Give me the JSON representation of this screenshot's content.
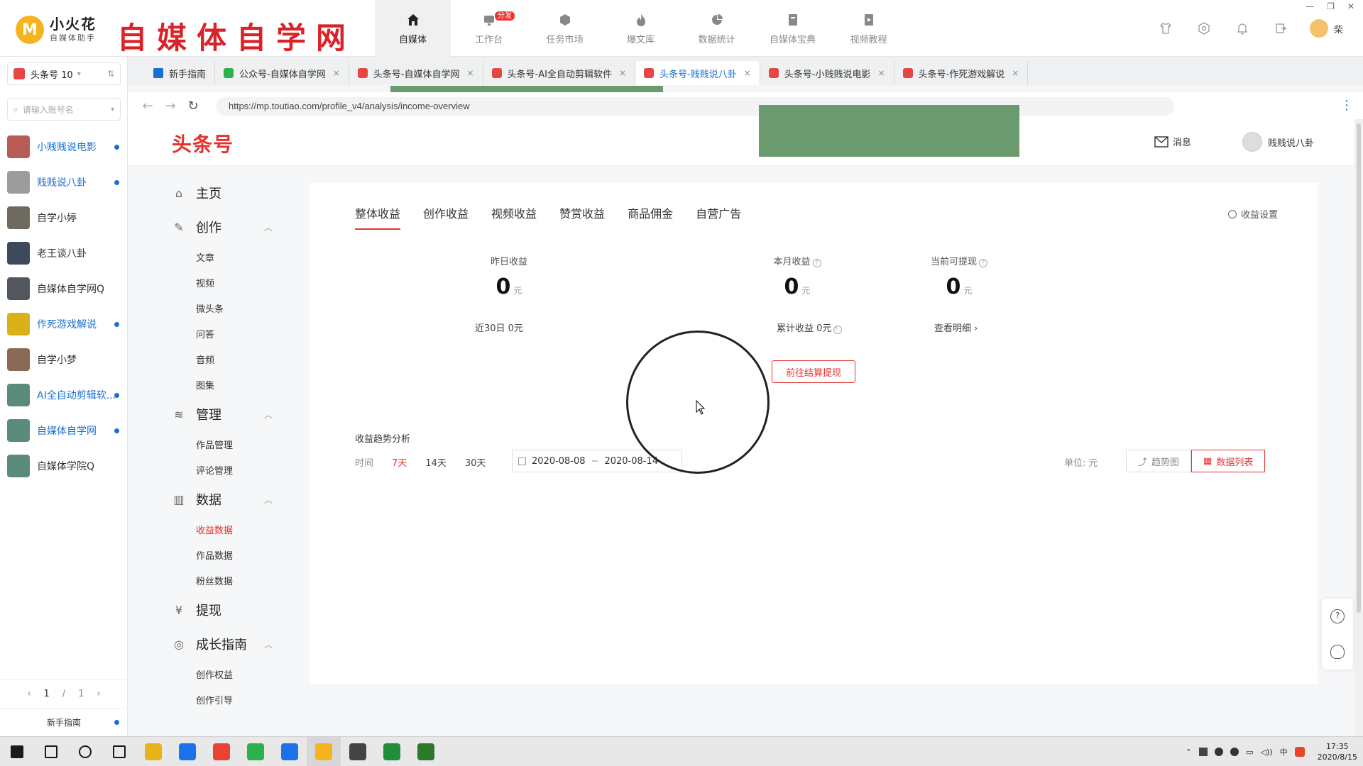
{
  "app": {
    "logo_name": "小火花",
    "logo_sub": "自媒体助手",
    "brand_banner": "自媒体自学网",
    "window_controls": [
      "—",
      "❐",
      "✕"
    ],
    "user_name": "柴"
  },
  "top_nav": [
    {
      "label": "自媒体",
      "icon": "home-icon",
      "active": true
    },
    {
      "label": "工作台",
      "icon": "workbench-icon",
      "badge": "分发"
    },
    {
      "label": "任务市场",
      "icon": "cube-icon"
    },
    {
      "label": "爆文库",
      "icon": "fire-icon"
    },
    {
      "label": "数据统计",
      "icon": "pie-chart-icon"
    },
    {
      "label": "自媒体宝典",
      "icon": "book-icon"
    },
    {
      "label": "视频教程",
      "icon": "video-doc-icon"
    }
  ],
  "header_icons": [
    "shirt-icon",
    "settings-hex-icon",
    "bell-icon",
    "logout-icon"
  ],
  "account_sidebar": {
    "platform": "头条号 10",
    "search_placeholder": "请输入账号名",
    "accounts": [
      {
        "name": "小贱贱说电影",
        "online": true,
        "color": "#b95b55"
      },
      {
        "name": "贱贱说八卦",
        "online": true,
        "color": "#9c9c9c"
      },
      {
        "name": "自学小婷",
        "online": false,
        "color": "#6f6a60"
      },
      {
        "name": "老王谈八卦",
        "online": false,
        "color": "#3d4a5b"
      },
      {
        "name": "自媒体自学网Q",
        "online": false,
        "color": "#52575d"
      },
      {
        "name": "作死游戏解说",
        "online": true,
        "color": "#d9b21a"
      },
      {
        "name": "自学小梦",
        "online": false,
        "color": "#8a6a55"
      },
      {
        "name": "AI全自动剪辑软...",
        "online": true,
        "color": "#5b8c7a"
      },
      {
        "name": "自媒体自学网",
        "online": true,
        "color": "#5b8c7a"
      },
      {
        "name": "自媒体学院Q",
        "online": false,
        "color": "#5b8c7a"
      }
    ],
    "pager": {
      "prev": "‹",
      "current": "1",
      "sep": "/",
      "total": "1",
      "next": "›"
    },
    "guide": "新手指南"
  },
  "browser": {
    "tabs": [
      {
        "label": "新手指南",
        "icon_color": "#1a6fd1",
        "closable": false
      },
      {
        "label": "公众号-自媒体自学网",
        "icon_color": "#2bb24c",
        "closable": true
      },
      {
        "label": "头条号-自媒体自学网",
        "icon_color": "#e84545",
        "closable": true
      },
      {
        "label": "头条号-AI全自动剪辑软件",
        "icon_color": "#e84545",
        "closable": true
      },
      {
        "label": "头条号-贱贱说八卦",
        "icon_color": "#e84545",
        "closable": true,
        "active": true
      },
      {
        "label": "头条号-小贱贱说电影",
        "icon_color": "#e84545",
        "closable": true
      },
      {
        "label": "头条号-作死游戏解说",
        "icon_color": "#e84545",
        "closable": true
      }
    ],
    "close_glyph": "×",
    "url": "https://mp.toutiao.com/profile_v4/analysis/income-overview"
  },
  "site": {
    "logo": "头条号",
    "messages": "消息",
    "user": "贱贱说八卦"
  },
  "site_nav": [
    {
      "title": "主页",
      "icon": "home-outline-icon",
      "items": []
    },
    {
      "title": "创作",
      "icon": "pen-icon",
      "collapsible": true,
      "items": [
        {
          "label": "文章"
        },
        {
          "label": "视频"
        },
        {
          "label": "微头条"
        },
        {
          "label": "问答"
        },
        {
          "label": "音频"
        },
        {
          "label": "图集"
        }
      ]
    },
    {
      "title": "管理",
      "icon": "layers-icon",
      "collapsible": true,
      "items": [
        {
          "label": "作品管理"
        },
        {
          "label": "评论管理"
        }
      ]
    },
    {
      "title": "数据",
      "icon": "bar-chart-icon",
      "collapsible": true,
      "items": [
        {
          "label": "收益数据",
          "active": true
        },
        {
          "label": "作品数据"
        },
        {
          "label": "粉丝数据"
        }
      ]
    },
    {
      "title": "提现",
      "icon": "yen-circle-icon",
      "items": []
    },
    {
      "title": "成长指南",
      "icon": "growth-icon",
      "collapsible": true,
      "items": [
        {
          "label": "创作权益"
        },
        {
          "label": "创作引导"
        }
      ]
    }
  ],
  "income": {
    "tabs": [
      "整体收益",
      "创作收益",
      "视频收益",
      "赞赏收益",
      "商品佣金",
      "自营广告"
    ],
    "settings": "收益设置",
    "stats": [
      {
        "label": "昨日收益",
        "value": "0",
        "unit": "元",
        "help": false
      },
      {
        "label": "本月收益",
        "value": "0",
        "unit": "元",
        "help": true
      },
      {
        "label": "当前可提现",
        "value": "0",
        "unit": "元",
        "help": true
      }
    ],
    "foot_30d": "近30日 0元",
    "foot_total": "累计收益 0元",
    "foot_detail": "查看明细 ›",
    "withdraw_button": "前往结算提现",
    "trend_title": "收益趋势分析",
    "time_label": "时间",
    "ranges": [
      "7天",
      "14天",
      "30天"
    ],
    "active_range": 0,
    "date_start": "2020-08-08",
    "date_sep": "~",
    "date_end": "2020-08-14",
    "unit": "单位: 元",
    "view_trend": "趋势图",
    "view_table": "数据列表"
  },
  "taskbar": {
    "apps": [
      "windows-start-icon",
      "search-icon",
      "cortana-icon",
      "task-view-icon",
      "file-explorer-icon",
      "browser-q-icon",
      "chrome-icon",
      "green-app-icon",
      "maps-pin-icon",
      "xiaohuohua-icon",
      "film-app-icon",
      "camtasia-icon",
      "terminal-app-icon"
    ],
    "ime": "中",
    "time": "17:35",
    "date": "2020/8/15"
  }
}
